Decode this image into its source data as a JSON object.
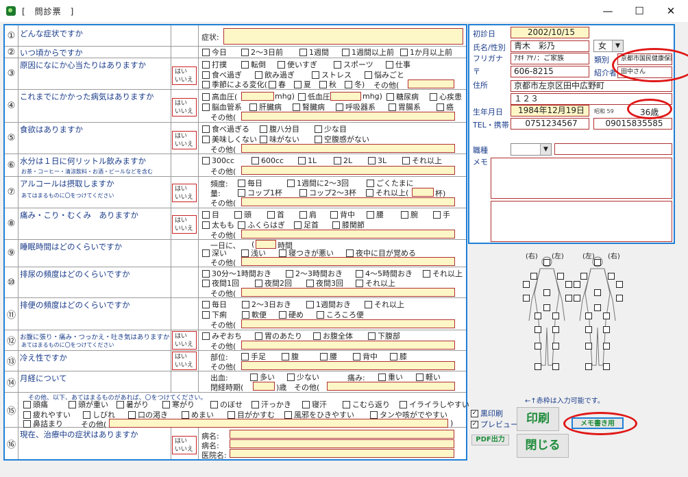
{
  "window": {
    "title": "[　問診票　]",
    "min": "—",
    "max": "☐",
    "close": "✕",
    "app_icon": "app-icon"
  },
  "q1": {
    "num": "①",
    "q": "どんな症状ですか",
    "label": "症状:"
  },
  "q2": {
    "num": "②",
    "q": "いつ頃からですか",
    "opts": [
      "今日",
      "2〜3日前",
      "1週間",
      "1週間以上前",
      "1か月以上前"
    ]
  },
  "q3": {
    "num": "③",
    "q": "原因になにか心当たりはありますか",
    "yn": [
      "はい",
      "いいえ"
    ],
    "r1": [
      "打撲",
      "転倒",
      "使いすぎ",
      "スポーツ",
      "仕事"
    ],
    "r2": [
      "食べ過ぎ",
      "飲み過ぎ",
      "ストレス",
      "悩みごと"
    ],
    "seasonal": "季節による変化(",
    "seasons": [
      "春",
      "夏",
      "秋",
      "冬)"
    ],
    "other": "その他("
  },
  "q4": {
    "num": "④",
    "q": "これまでにかかった病気はありますか",
    "yn": [
      "はい",
      "いいえ"
    ],
    "hbp": "高血圧(",
    "lbp": "低血圧(",
    "unit": "mhg)",
    "r1": [
      "糖尿病",
      "心疾患"
    ],
    "r2": [
      "脳血管系",
      "肝臓病",
      "腎臓病",
      "呼吸器系",
      "胃腸系",
      "癌"
    ],
    "other": "その他("
  },
  "q5": {
    "num": "⑤",
    "q": "食欲はありますか",
    "yn": [
      "はい",
      "いいえ"
    ],
    "r1": [
      "食べ過ぎる",
      "腹八分目",
      "少な目"
    ],
    "r2": [
      "美味しくない",
      "味がない",
      "空腹感がない"
    ],
    "other": "その他("
  },
  "q6": {
    "num": "⑥",
    "q": "水分は１日に何リットル飲みますか",
    "sub": "お茶・コーヒー・清涼飲料・お酒・ビールなどを含む",
    "opts": [
      "300cc",
      "600cc",
      "1L",
      "2L",
      "3L",
      "それ以上"
    ],
    "other": "その他("
  },
  "q7": {
    "num": "⑦",
    "q": "アルコールは摂取しますか",
    "sub": "あてはまるものに〇をつけてください",
    "yn": [
      "はい",
      "いいえ"
    ],
    "freq": "頻度:",
    "f_opts": [
      "毎日",
      "1週間に2〜3回",
      "ごくたまに"
    ],
    "amt": "量:",
    "a_opts": [
      "コップ1杯",
      "コップ2〜3杯",
      "それ以上("
    ],
    "cup": "杯)",
    "other": "その他("
  },
  "q8": {
    "num": "⑧",
    "q": "痛み・こり・むくみ　ありますか",
    "yn": [
      "はい",
      "いいえ"
    ],
    "r1": [
      "目",
      "頭",
      "首",
      "肩",
      "背中",
      "腰",
      "腕",
      "手"
    ],
    "r2": [
      "太もも",
      "ふくらはぎ",
      "足首",
      "膝関節"
    ],
    "other": "その他("
  },
  "q9": {
    "num": "⑨",
    "q": "睡眠時間はどのくらいですか",
    "day": "一日に、",
    "hours": "時間",
    "opts": [
      "深い",
      "浅い",
      "寝つきが悪い",
      "夜中に目が覚める"
    ],
    "other": "その他("
  },
  "q10": {
    "num": "⑩",
    "q": "排尿の頻度はどのくらいですか",
    "r1": [
      "30分〜1時間おき",
      "2〜3時間おき",
      "4〜5時間おき",
      "それ以上"
    ],
    "r2": [
      "夜間1回",
      "夜間2回",
      "夜間3回",
      "それ以上"
    ],
    "other": "その他("
  },
  "q11": {
    "num": "⑪",
    "q": "排便の頻度はどのくらいですか",
    "r1": [
      "毎日",
      "2〜3日おき",
      "1週間おき",
      "それ以上"
    ],
    "r2": [
      "下痢",
      "軟便",
      "硬め",
      "ころころ便"
    ],
    "other": "その他("
  },
  "q12": {
    "num": "⑫",
    "q": "お腹に張り・痛み・つっかえ・吐き気はありますか",
    "sub": "あてはまるものに〇をつけてください",
    "yn": [
      "はい",
      "いいえ"
    ],
    "opts": [
      "みぞおち",
      "胃のあたり",
      "お腹全体",
      "下腹部"
    ],
    "other": "その他("
  },
  "q13": {
    "num": "⑬",
    "q": "冷え性ですか",
    "yn": [
      "はい",
      "いいえ"
    ],
    "part": "部位:",
    "opts": [
      "手足",
      "腹",
      "腰",
      "背中",
      "膝"
    ],
    "other": "その他("
  },
  "q14": {
    "num": "⑭",
    "q": "月経について",
    "flow": "出血:",
    "f_opts": [
      "多い",
      "少ない"
    ],
    "pain": "痛み:",
    "p_opts": [
      "重い",
      "軽い"
    ],
    "closed": "閉経時期(",
    "age": ")歳",
    "other": "その他("
  },
  "q15": {
    "num": "⑮",
    "note": "その他、以下、あてはまるものがあれば、〇をつけてください。",
    "r1": [
      "頭痛",
      "頭が重い",
      "暑がり",
      "寒がり",
      "のぼせ",
      "汗っかき",
      "寝汗",
      "こむら返り",
      "イライラしやすい"
    ],
    "r2": [
      "疲れやすい",
      "しびれ",
      "口の渇き",
      "めまい",
      "目がかすむ",
      "風邪をひきやすい",
      "タンや咳がでやすい"
    ],
    "r3": [
      "鼻詰まり"
    ],
    "other": "その他(",
    "close": ")"
  },
  "q16": {
    "num": "⑯",
    "q": "現在、治療中の症状はありますか",
    "yn": [
      "はい",
      "いいえ"
    ],
    "l1": "病名:",
    "l2": "病名:",
    "l3": "医院名:"
  },
  "patient": {
    "first_visit_label": "初診日",
    "first_visit": "2002/10/15",
    "name_label": "氏名/性別",
    "name": "青木　彩乃",
    "sex": "女",
    "kana_label": "フリガナ",
    "kana": "ｱｵｷ ｱﾔﾉ：ご家族",
    "type_label": "類別",
    "type": "京都市国民健康保険",
    "zip_label": "〒",
    "zip": "606-8215",
    "intro_label": "紹介者",
    "intro": "田中さん",
    "addr_label": "住所",
    "addr1": "京都市左京区田中広野町",
    "addr2": "１２３",
    "dob_label": "生年月日",
    "dob": "1984年12月19日",
    "era": "昭和 59",
    "age": "36歳",
    "tel_label": "TEL・携帯",
    "tel": "0751234567",
    "mobile": "09015835585",
    "job_label": "職種",
    "memo_label": "メモ"
  },
  "body": {
    "right1": "(右)",
    "left1": "(左)",
    "left2": "(左)",
    "right2": "(右)"
  },
  "footer": {
    "hint": "←↑赤枠は入力可能です。",
    "bw_label": "黒印刷",
    "preview_label": "プレビュー",
    "print": "印刷",
    "memo_print": "メモ書き用",
    "pdf": "PDF出力",
    "close": "閉じる"
  }
}
